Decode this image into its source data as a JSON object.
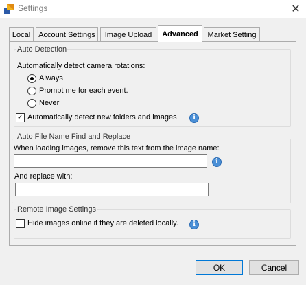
{
  "window": {
    "title": "Settings",
    "close_glyph": "✕"
  },
  "tabs": [
    {
      "label": "Local",
      "active": false
    },
    {
      "label": "Account Settings",
      "active": false
    },
    {
      "label": "Image Upload",
      "active": false
    },
    {
      "label": "Advanced",
      "active": true
    },
    {
      "label": "Market Setting",
      "active": false
    }
  ],
  "auto_detection": {
    "title": "Auto Detection",
    "rotation_prompt": "Automatically detect camera rotations:",
    "options": [
      {
        "label": "Always",
        "selected": true
      },
      {
        "label": "Prompt me for each event.",
        "selected": false
      },
      {
        "label": "Never",
        "selected": false
      }
    ],
    "detect_folders": {
      "label": "Automatically detect new folders and images",
      "checked": true
    }
  },
  "file_name": {
    "title": "Auto File Name Find and Replace",
    "remove_label": "When loading images, remove this text from the image name:",
    "remove_value": "",
    "replace_label": "And replace with:",
    "replace_value": ""
  },
  "remote": {
    "title": "Remote Image Settings",
    "hide_deleted": {
      "label": "Hide images online if they are deleted locally.",
      "checked": false
    }
  },
  "buttons": {
    "ok": "OK",
    "cancel": "Cancel"
  },
  "glyphs": {
    "check": "✓",
    "info": "i"
  }
}
